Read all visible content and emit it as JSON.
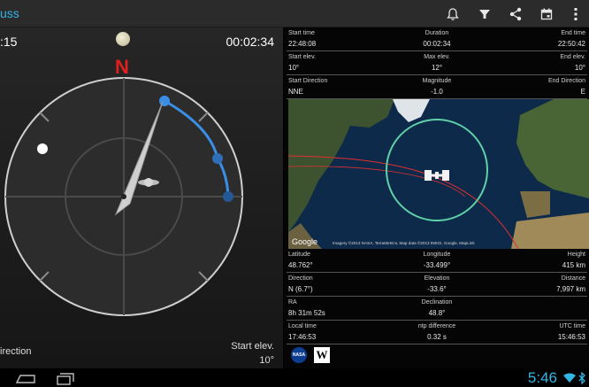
{
  "app": {
    "title": "uss"
  },
  "toolbar": {
    "icons": [
      "alarm-icon",
      "filter-icon",
      "share-icon",
      "calendar-icon",
      "overflow-menu-icon"
    ]
  },
  "left_panel": {
    "countdown_left": ":15",
    "countdown_right": "00:02:34",
    "north_label": "N",
    "bottom_left_label": "irection",
    "bottom_right_label": "Start elev.",
    "bottom_right_value": "10°"
  },
  "pass_info": [
    {
      "labels": [
        "Start time",
        "Duration",
        "End time"
      ],
      "values": [
        "22:48:08",
        "00:02:34",
        "22:50:42"
      ]
    },
    {
      "labels": [
        "Start elev.",
        "Max elev.",
        "End elev."
      ],
      "values": [
        "10°",
        "12°",
        "10°"
      ]
    },
    {
      "labels": [
        "Start Direction",
        "Magnitude",
        "End Direction"
      ],
      "values": [
        "NNE",
        "-1.0",
        "E"
      ]
    }
  ],
  "map": {
    "google_logo": "Google",
    "attribution": "Imagery ©2013 NASA, TerraMetrics, Map data ©2013 INEGI, Google, MapLink"
  },
  "position_info": [
    {
      "labels": [
        "Latitude",
        "Longitude",
        "Height"
      ],
      "values": [
        "48.762°",
        "-33.499°",
        "415 km"
      ]
    },
    {
      "labels": [
        "Direction",
        "Elevation",
        "Distance"
      ],
      "values": [
        "N (6.7°)",
        "-33.6°",
        "7,997 km"
      ]
    },
    {
      "labels": [
        "RA",
        "Declination",
        ""
      ],
      "values": [
        "8h 31m 52s",
        "48.8°",
        ""
      ]
    },
    {
      "labels": [
        "Local time",
        "ntp difference",
        "UTC time"
      ],
      "values": [
        "17:46:53",
        "0.32 s",
        "15:46:53"
      ]
    }
  ],
  "logos": {
    "nasa": "NASA",
    "wikipedia": "W"
  },
  "status_bar": {
    "clock": "5:46"
  },
  "colors": {
    "accent": "#33b5e5",
    "north": "#e0201e",
    "orbit": "#3a8ee6",
    "footprint": "#5fd0a8",
    "ground_track": "#e03030"
  }
}
